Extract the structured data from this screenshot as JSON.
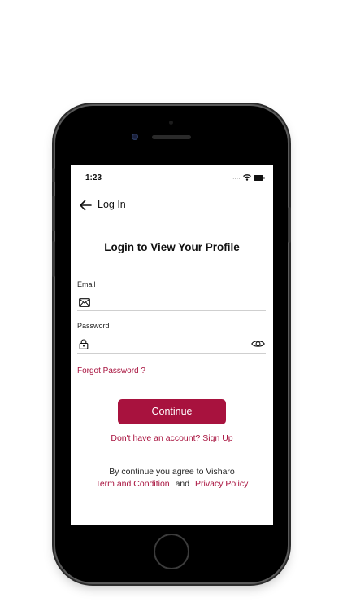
{
  "status_bar": {
    "time": "1:23",
    "signal_icon": "signal-dots-icon",
    "wifi_icon": "wifi-icon",
    "battery_icon": "battery-icon"
  },
  "nav": {
    "back_icon": "arrow-left-icon",
    "title": "Log In"
  },
  "page": {
    "title": "Login to View Your Profile"
  },
  "form": {
    "email": {
      "label": "Email",
      "icon": "envelope-icon",
      "value": "",
      "placeholder": ""
    },
    "password": {
      "label": "Password",
      "icon": "lock-icon",
      "toggle_icon": "eye-icon",
      "value": "",
      "placeholder": ""
    },
    "forgot_label": "Forgot Password ?",
    "continue_label": "Continue",
    "signup_label": "Don't have an account? Sign Up"
  },
  "footer": {
    "agree_text": "By continue you agree to Visharo",
    "terms_label": "Term and Condition",
    "and_text": "and",
    "privacy_label": "Privacy Policy"
  },
  "colors": {
    "accent": "#a8123e",
    "text": "#111111",
    "divider": "#cfcfcf"
  }
}
